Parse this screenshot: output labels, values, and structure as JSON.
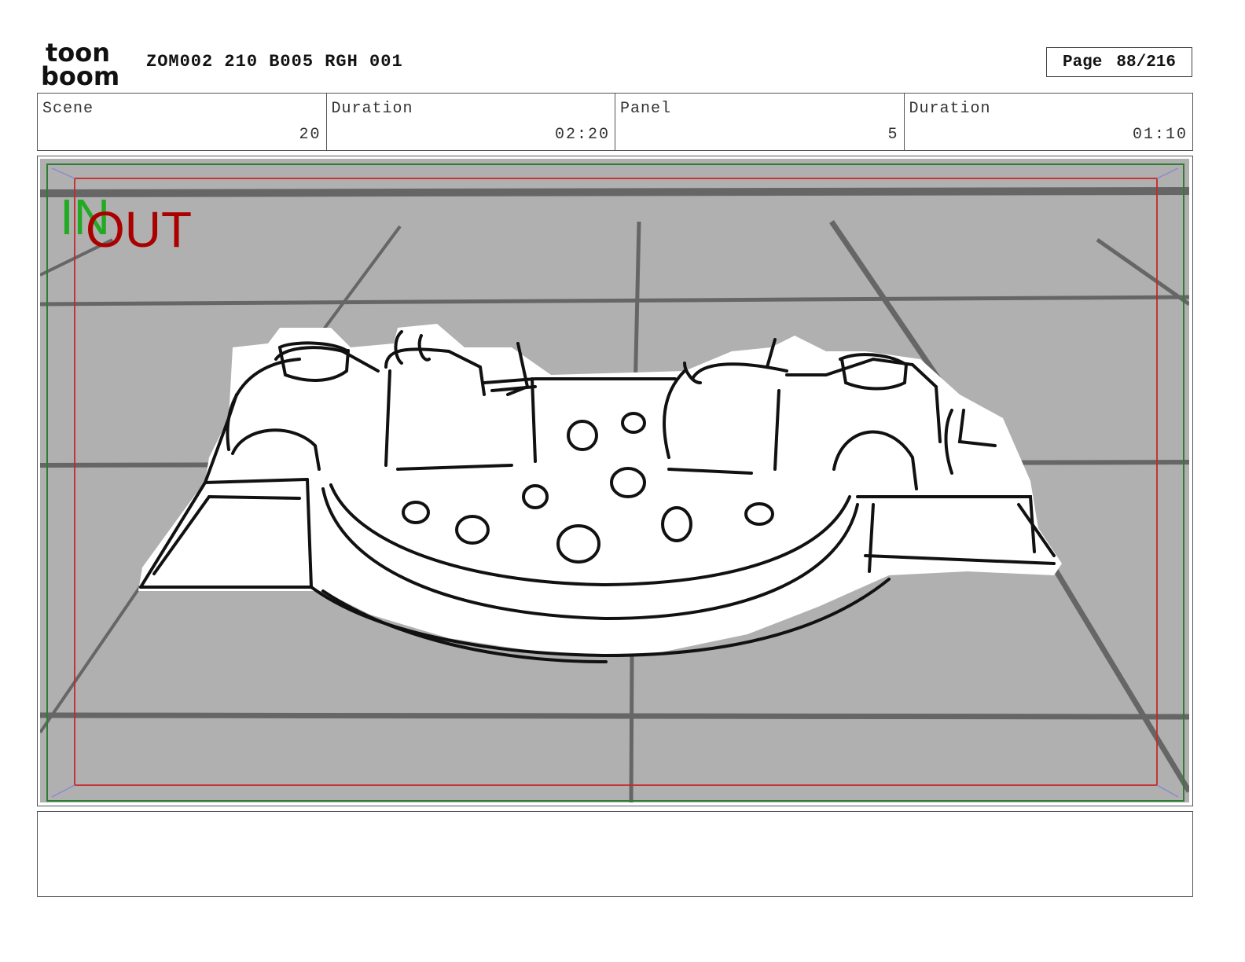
{
  "header": {
    "logo_text_top": "toon",
    "logo_text_bottom": "boom",
    "project_title": "ZOM002 210 B005 RGH 001",
    "page_label": "Page",
    "page_number": "88/216"
  },
  "info": {
    "scene_label": "Scene",
    "scene_value": "20",
    "scene_duration_label": "Duration",
    "scene_duration_value": "02:20",
    "panel_label": "Panel",
    "panel_value": "5",
    "panel_duration_label": "Duration",
    "panel_duration_value": "01:10"
  },
  "panel": {
    "in_label": "IN",
    "out_label": "OUT",
    "colors": {
      "background": "#b0b0b0",
      "grid": "#666666",
      "safe_frame": "#2e7d32",
      "action_frame": "#c62828",
      "in_text": "#22aa22",
      "out_text": "#aa0000"
    }
  },
  "notes": {
    "text": ""
  }
}
